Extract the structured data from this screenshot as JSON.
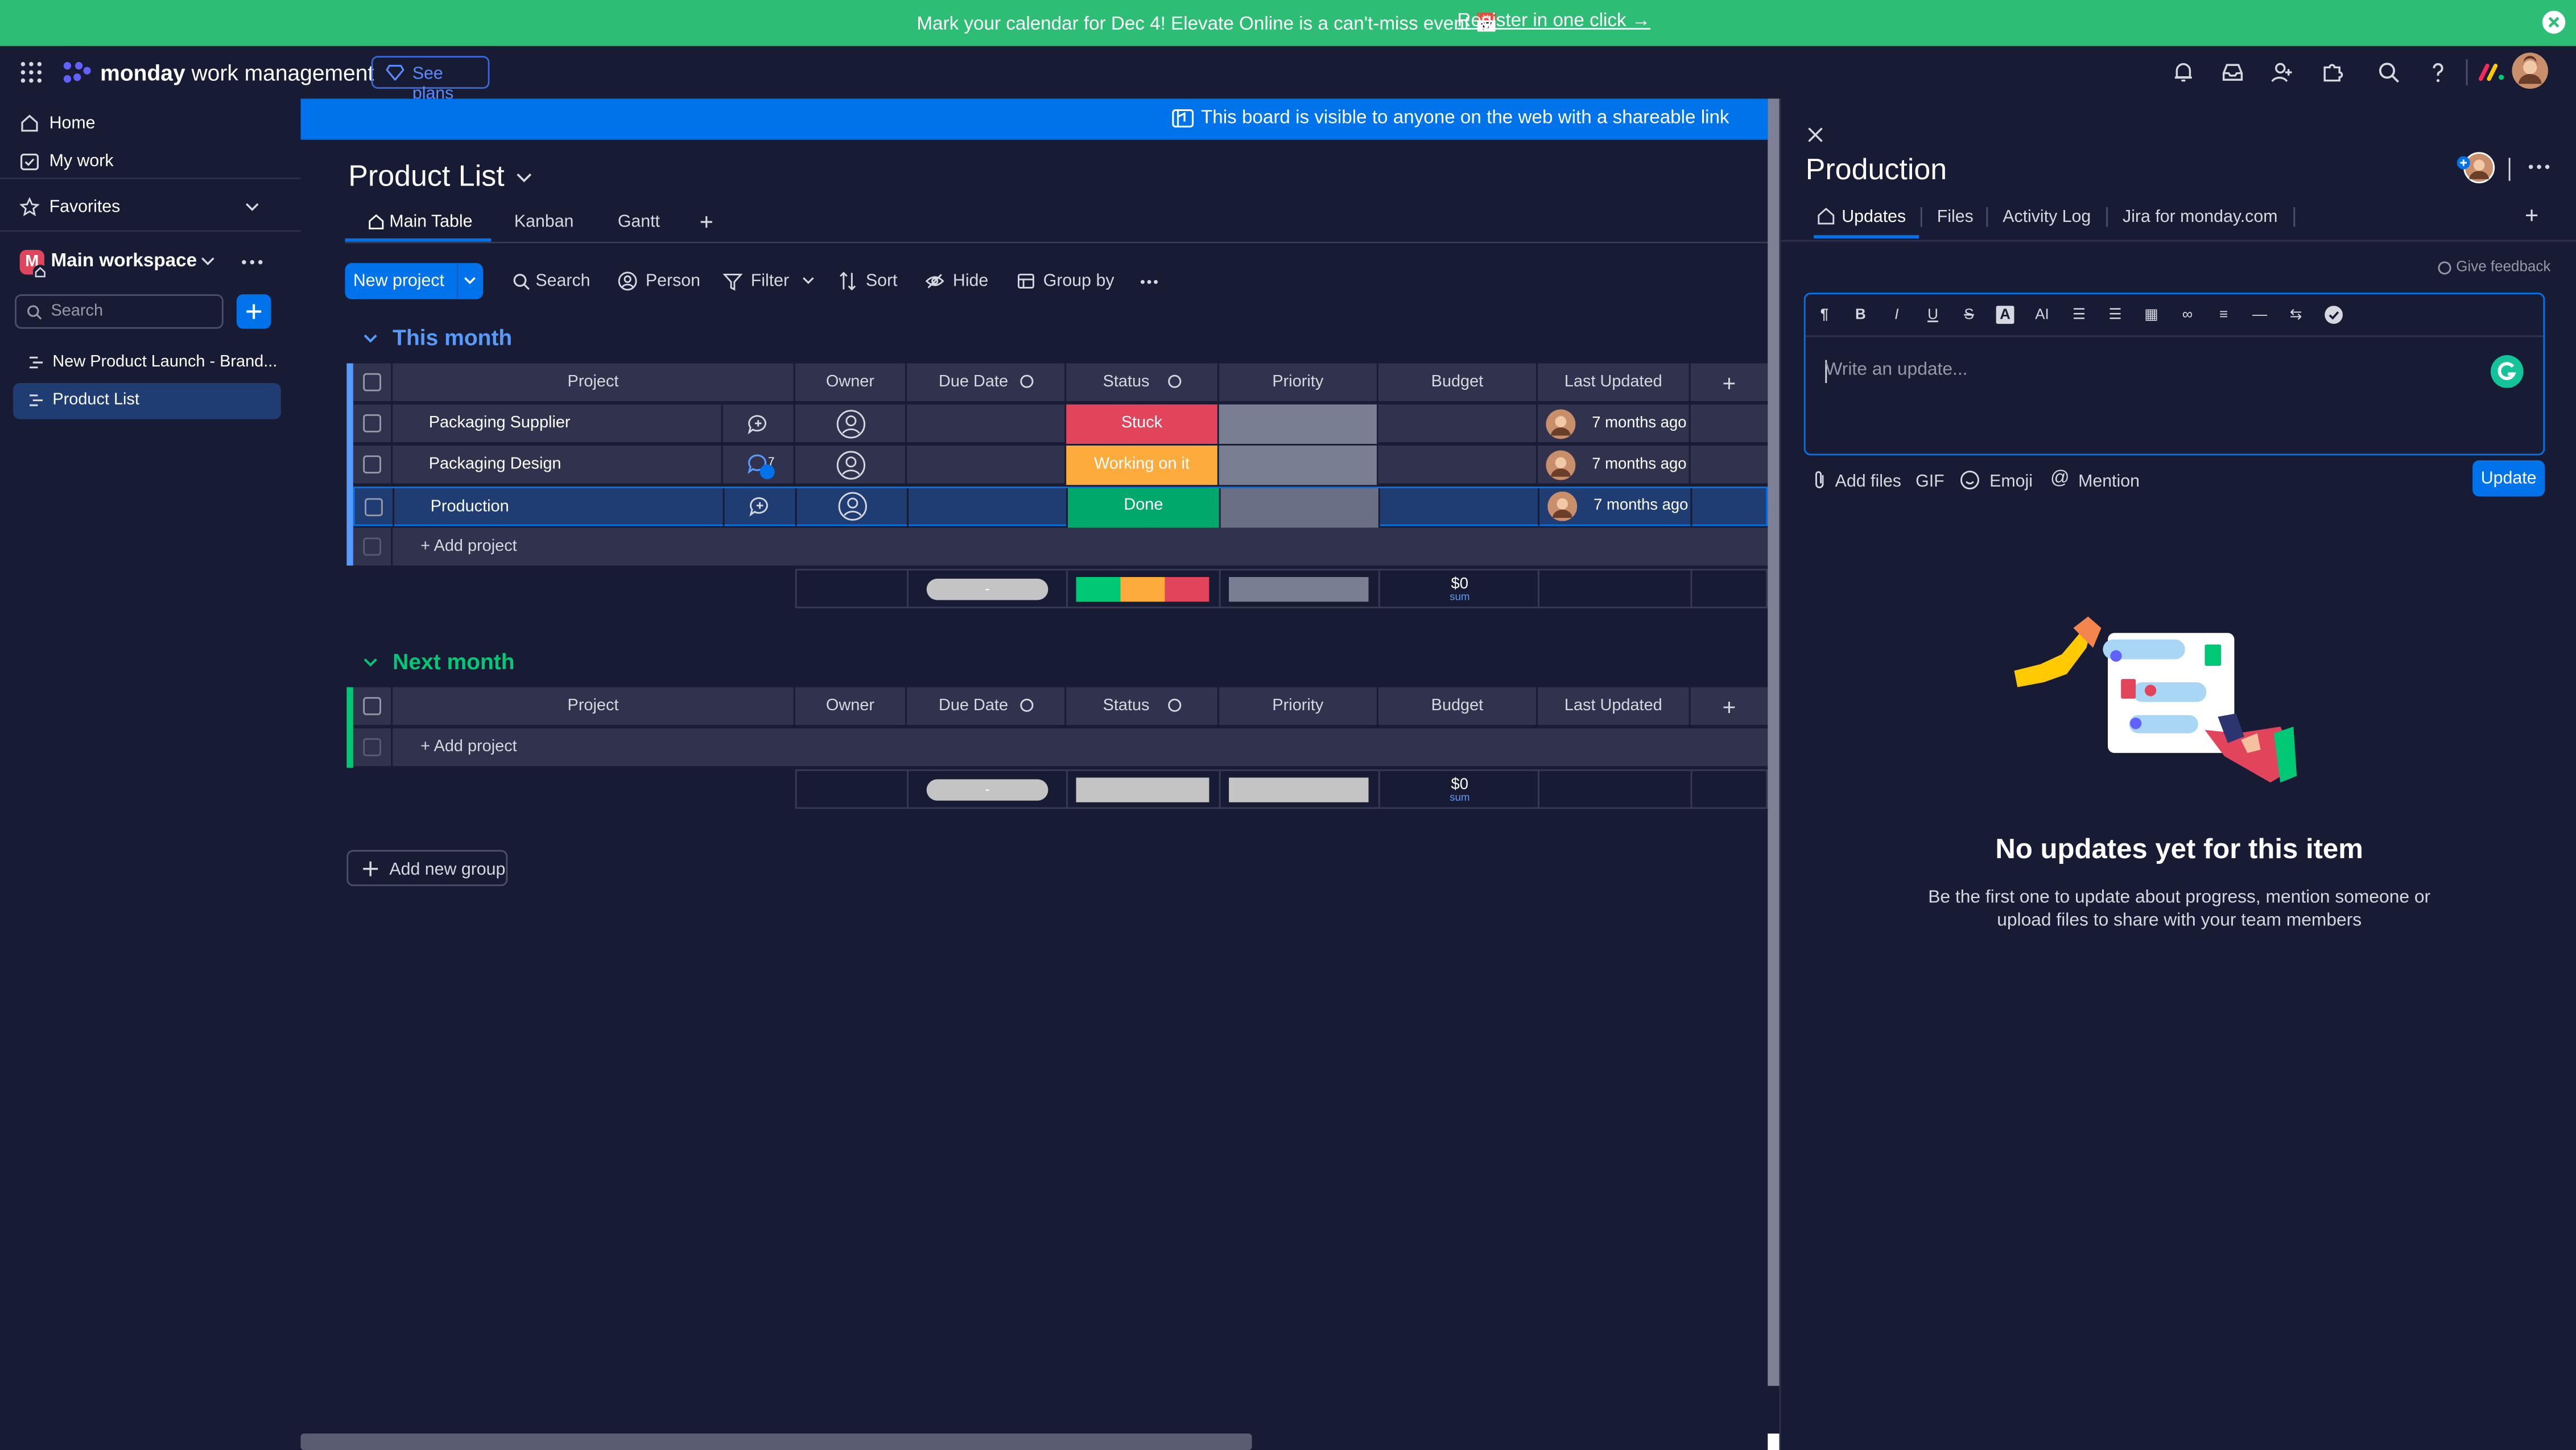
{
  "promo": {
    "message": "Mark your calendar for Dec 4! Elevate Online is a can't-miss event 📅",
    "link": "Register in one click →"
  },
  "topnav": {
    "brand_bold": "monday",
    "brand_rest": "work management",
    "see_plans": "See plans",
    "icons": [
      "bell-icon",
      "inbox-icon",
      "invite-icon",
      "apps-icon",
      "search-icon",
      "help-icon"
    ]
  },
  "sidebar": {
    "home": "Home",
    "my_work": "My work",
    "favorites": "Favorites",
    "workspace_initial": "M",
    "workspace": "Main workspace",
    "search_placeholder": "Search",
    "boards": [
      "New Product Launch - Brand...",
      "Product List"
    ]
  },
  "banner": "This board is visible to anyone on the web with a shareable link",
  "board": {
    "title": "Product List",
    "tabs": [
      "Main Table",
      "Kanban",
      "Gantt"
    ],
    "toolbar": {
      "new_item": "New project",
      "search": "Search",
      "person": "Person",
      "filter": "Filter",
      "sort": "Sort",
      "hide": "Hide",
      "group_by": "Group by"
    },
    "columns": [
      "Project",
      "Owner",
      "Due Date",
      "Status",
      "Priority",
      "Budget",
      "Last Updated"
    ],
    "add_item": "+ Add project",
    "add_group": "Add new group",
    "groups": [
      {
        "title": "This month",
        "color": "#579bfc",
        "rows": [
          {
            "name": "Packaging Supplier",
            "status": "Stuck",
            "status_color": "#e2445c",
            "updated": "7 months ago",
            "updates_count": ""
          },
          {
            "name": "Packaging Design",
            "status": "Working on it",
            "status_color": "#fdab3d",
            "updated": "7 months ago",
            "updates_count": "7"
          },
          {
            "name": "Production",
            "status": "Done",
            "status_color": "#00c875",
            "updated": "7 months ago",
            "updates_count": ""
          }
        ],
        "summary": {
          "due_date": "-",
          "budget": "$0",
          "budget_label": "sum"
        }
      },
      {
        "title": "Next month",
        "color": "#00c875",
        "rows": [],
        "summary": {
          "due_date": "-",
          "budget": "$0",
          "budget_label": "sum"
        }
      }
    ]
  },
  "panel": {
    "title": "Production",
    "tabs": [
      "Updates",
      "Files",
      "Activity Log",
      "Jira for monday.com"
    ],
    "feedback": "Give feedback",
    "editor_placeholder": "Write an update...",
    "footer": {
      "add_files": "Add files",
      "gif": "GIF",
      "emoji": "Emoji",
      "mention": "Mention",
      "update": "Update"
    },
    "empty_title": "No updates yet for this item",
    "empty_subtitle": "Be the first one to update about progress, mention someone or upload files to share with your team members"
  },
  "colors": {
    "accent": "#0073ea",
    "promo": "#2dbd74",
    "background": "#181b34",
    "row": "#30324e"
  }
}
